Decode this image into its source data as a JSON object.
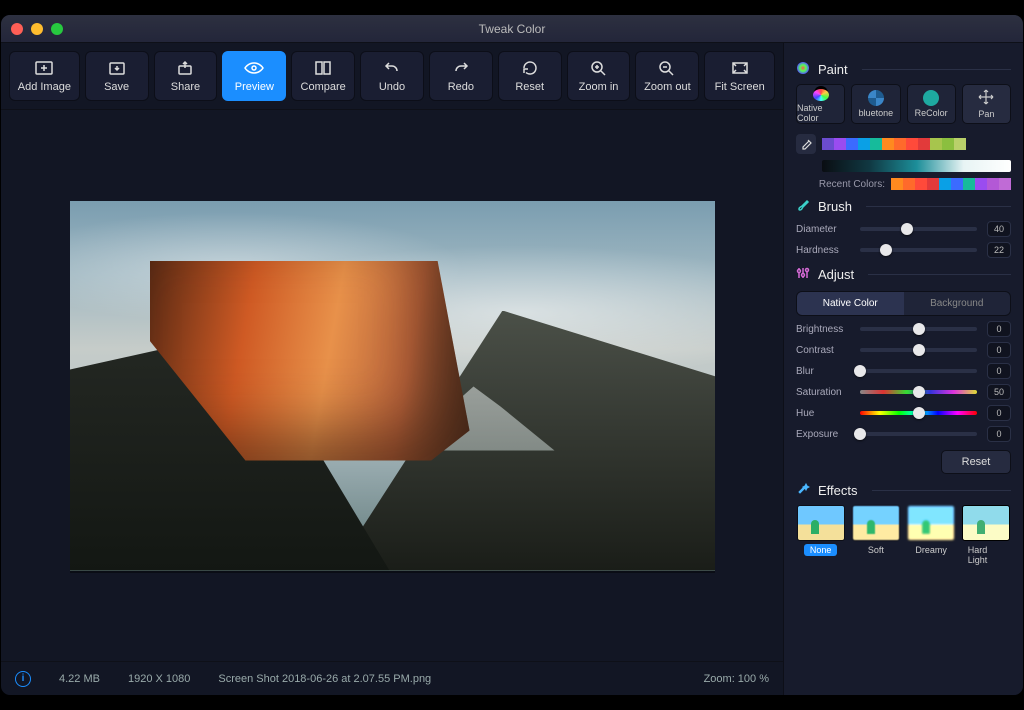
{
  "window": {
    "title": "Tweak Color"
  },
  "toolbar": {
    "add_image": "Add Image",
    "save": "Save",
    "share": "Share",
    "preview": "Preview",
    "compare": "Compare",
    "undo": "Undo",
    "redo": "Redo",
    "reset": "Reset",
    "zoom_in": "Zoom in",
    "zoom_out": "Zoom out",
    "fit_screen": "Fit Screen"
  },
  "status": {
    "size": "4.22 MB",
    "dimensions": "1920 X 1080",
    "filename": "Screen Shot 2018-06-26 at 2.07.55 PM.png",
    "zoom": "Zoom: 100 %"
  },
  "paint": {
    "section": "Paint",
    "native": "Native Color",
    "bluetone": "bluetone",
    "recolor": "ReColor",
    "pan": "Pan",
    "swatches": [
      "#6b4ccf",
      "#9a4cf0",
      "#3b6bff",
      "#0aa0e6",
      "#16bb9b",
      "#ff8a1f",
      "#ff6a2b",
      "#ff4a3a",
      "#e23a3a",
      "#a7c54d",
      "#8bbf3f",
      "#b9d06a"
    ],
    "recent_label": "Recent Colors:",
    "recent": [
      "#ff8a1f",
      "#ff6a2b",
      "#ff4a3a",
      "#e23a3a",
      "#0aa0e6",
      "#3b6bff",
      "#16bb9b",
      "#9a4cf0",
      "#b358d6",
      "#c06bd6"
    ]
  },
  "brush": {
    "section": "Brush",
    "diameter_label": "Diameter",
    "diameter_value": "40",
    "hardness_label": "Hardness",
    "hardness_value": "22"
  },
  "adjust": {
    "section": "Adjust",
    "tab_native": "Native Color",
    "tab_background": "Background",
    "brightness_label": "Brightness",
    "brightness_value": "0",
    "contrast_label": "Contrast",
    "contrast_value": "0",
    "blur_label": "Blur",
    "blur_value": "0",
    "saturation_label": "Saturation",
    "saturation_value": "50",
    "hue_label": "Hue",
    "hue_value": "0",
    "exposure_label": "Exposure",
    "exposure_value": "0",
    "reset": "Reset"
  },
  "effects": {
    "section": "Effects",
    "none": "None",
    "soft": "Soft",
    "dreamy": "Dreamy",
    "hardlight": "Hard Light"
  }
}
